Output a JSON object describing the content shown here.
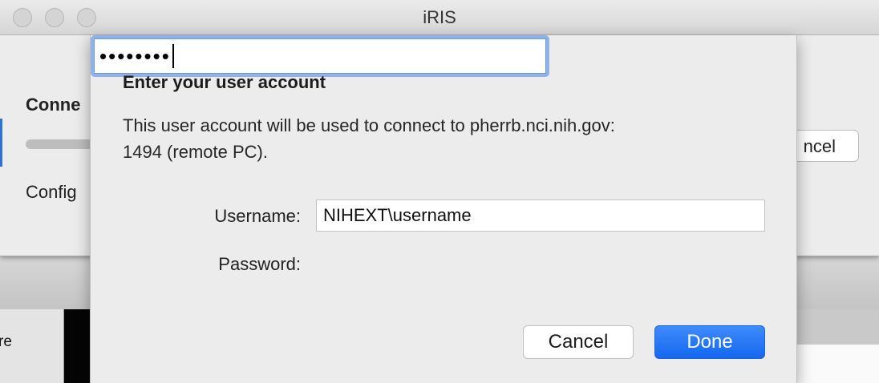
{
  "window": {
    "title": "iRIS"
  },
  "background": {
    "heading": "Conne",
    "status": "Config",
    "cancel_label": "ncel",
    "lower_left_text": "re"
  },
  "dialog": {
    "title": "Enter your user account",
    "message": "This user account will be used to connect to pherrb.nci.nih.gov:\n1494 (remote PC).",
    "username_label": "Username:",
    "username_value": "NIHEXT\\username",
    "password_label": "Password:",
    "password_mask": "••••••••",
    "cancel_label": "Cancel",
    "done_label": "Done"
  },
  "colors": {
    "accent": "#1468f0",
    "focus_ring": "#8fb2ea",
    "window_bg": "#ececec"
  }
}
